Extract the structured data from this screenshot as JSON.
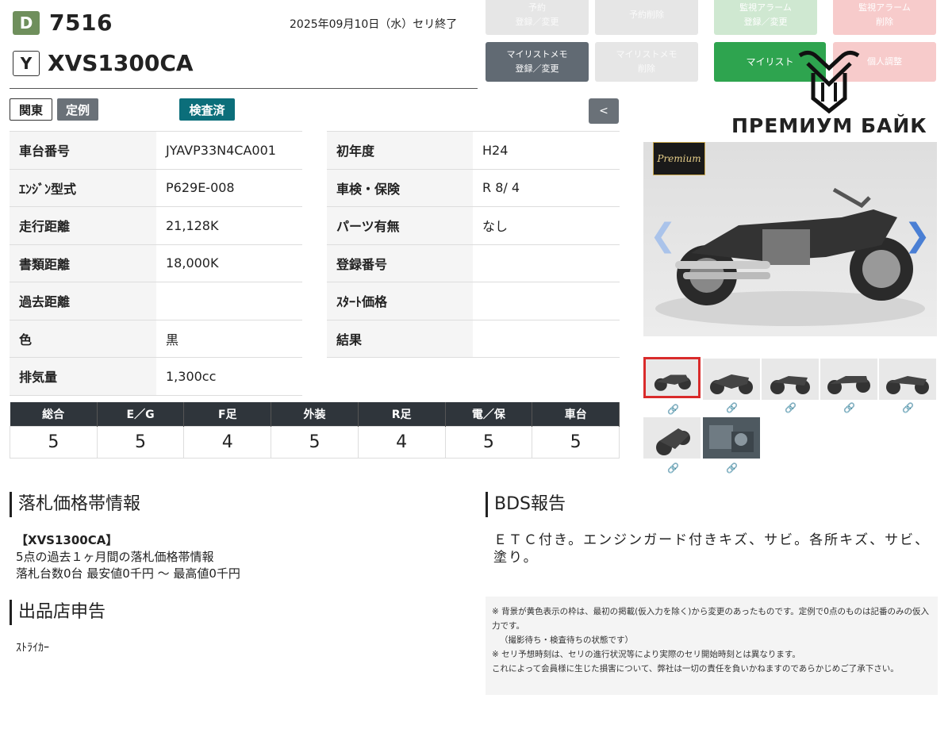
{
  "header": {
    "grade_badge": "D",
    "lot_number": "7516",
    "maker_badge": "Y",
    "model": "XVS1300CA",
    "auction_date": "2025年09月10日（水）セリ終了"
  },
  "buttons": {
    "reserve": [
      "予約",
      "登録／変更"
    ],
    "reserve_delete": [
      "予約削除"
    ],
    "alarm": [
      "監視アラーム",
      "登録／変更"
    ],
    "alarm_delete": [
      "監視アラーム",
      "削除"
    ],
    "mylist_memo": [
      "マイリストメモ",
      "登録／変更"
    ],
    "mylist_memo_delete": [
      "マイリストメモ",
      "削除"
    ],
    "mylist": [
      "マイリスト"
    ],
    "personal_adjust": [
      "個人調整"
    ]
  },
  "tags": {
    "region": "関東",
    "type": "定例",
    "inspection": "検査済",
    "collapse": "<"
  },
  "spec_left": [
    {
      "label": "車台番号",
      "value": "JYAVP33N4CA001"
    },
    {
      "label": "ｴﾝｼﾞﾝ型式",
      "value": "P629E-008"
    },
    {
      "label": "走行距離",
      "value": "21,128K"
    },
    {
      "label": "書類距離",
      "value": "18,000K"
    },
    {
      "label": "過去距離",
      "value": ""
    },
    {
      "label": "色",
      "value": "黒"
    },
    {
      "label": "排気量",
      "value": "1,300cc"
    }
  ],
  "spec_right": [
    {
      "label": "初年度",
      "value": "H24"
    },
    {
      "label": "車検・保険",
      "value": "R 8/ 4"
    },
    {
      "label": "パーツ有無",
      "value": "なし"
    },
    {
      "label": "登録番号",
      "value": ""
    },
    {
      "label": "ｽﾀｰﾄ価格",
      "value": ""
    },
    {
      "label": "結果",
      "value": ""
    }
  ],
  "ratings": {
    "headers": [
      "総合",
      "E／G",
      "F足",
      "外装",
      "R足",
      "電／保",
      "車台"
    ],
    "values": [
      "5",
      "5",
      "4",
      "5",
      "4",
      "5",
      "5"
    ]
  },
  "price_section": {
    "title": "落札価格帯情報",
    "lines": [
      "【XVS1300CA】",
      "5点の過去１ヶ月間の落札価格帯情報",
      "落札台数0台 最安値0千円 〜 最高値0千円"
    ]
  },
  "seller_section": {
    "title": "出品店申告",
    "text": "ｽﾄﾗｲｶｰ"
  },
  "bds_section": {
    "title": "BDS報告",
    "text": "ＥＴＣ付き。エンジンガード付きキズ、サビ。各所キズ、サビ、塗り。"
  },
  "notes": [
    "※ 背景が黄色表示の枠は、最初の掲載(仮入力を除く)から変更のあったものです。定例で0点のものは記番のみの仮入力です。",
    "（撮影待ち・検査待ちの状態です）",
    "※ セリ予想時刻は、セリの進行状況等により実際のセリ開始時刻とは異なります。",
    "これによって会員様に生じた損害について、弊社は一切の責任を負いかねますのであらかじめご了承下さい。"
  ],
  "watermark": {
    "text": "ПРЕМИУМ БАЙК"
  },
  "photo": {
    "badge_text": "Premium"
  },
  "colors": {
    "grade_badge": "#6f8f5c",
    "inspection_tag": "#0b6e7a",
    "mylist_button": "#2ea44f",
    "ratings_header": "#2f353b",
    "active_thumb_border": "#d92b2b"
  }
}
